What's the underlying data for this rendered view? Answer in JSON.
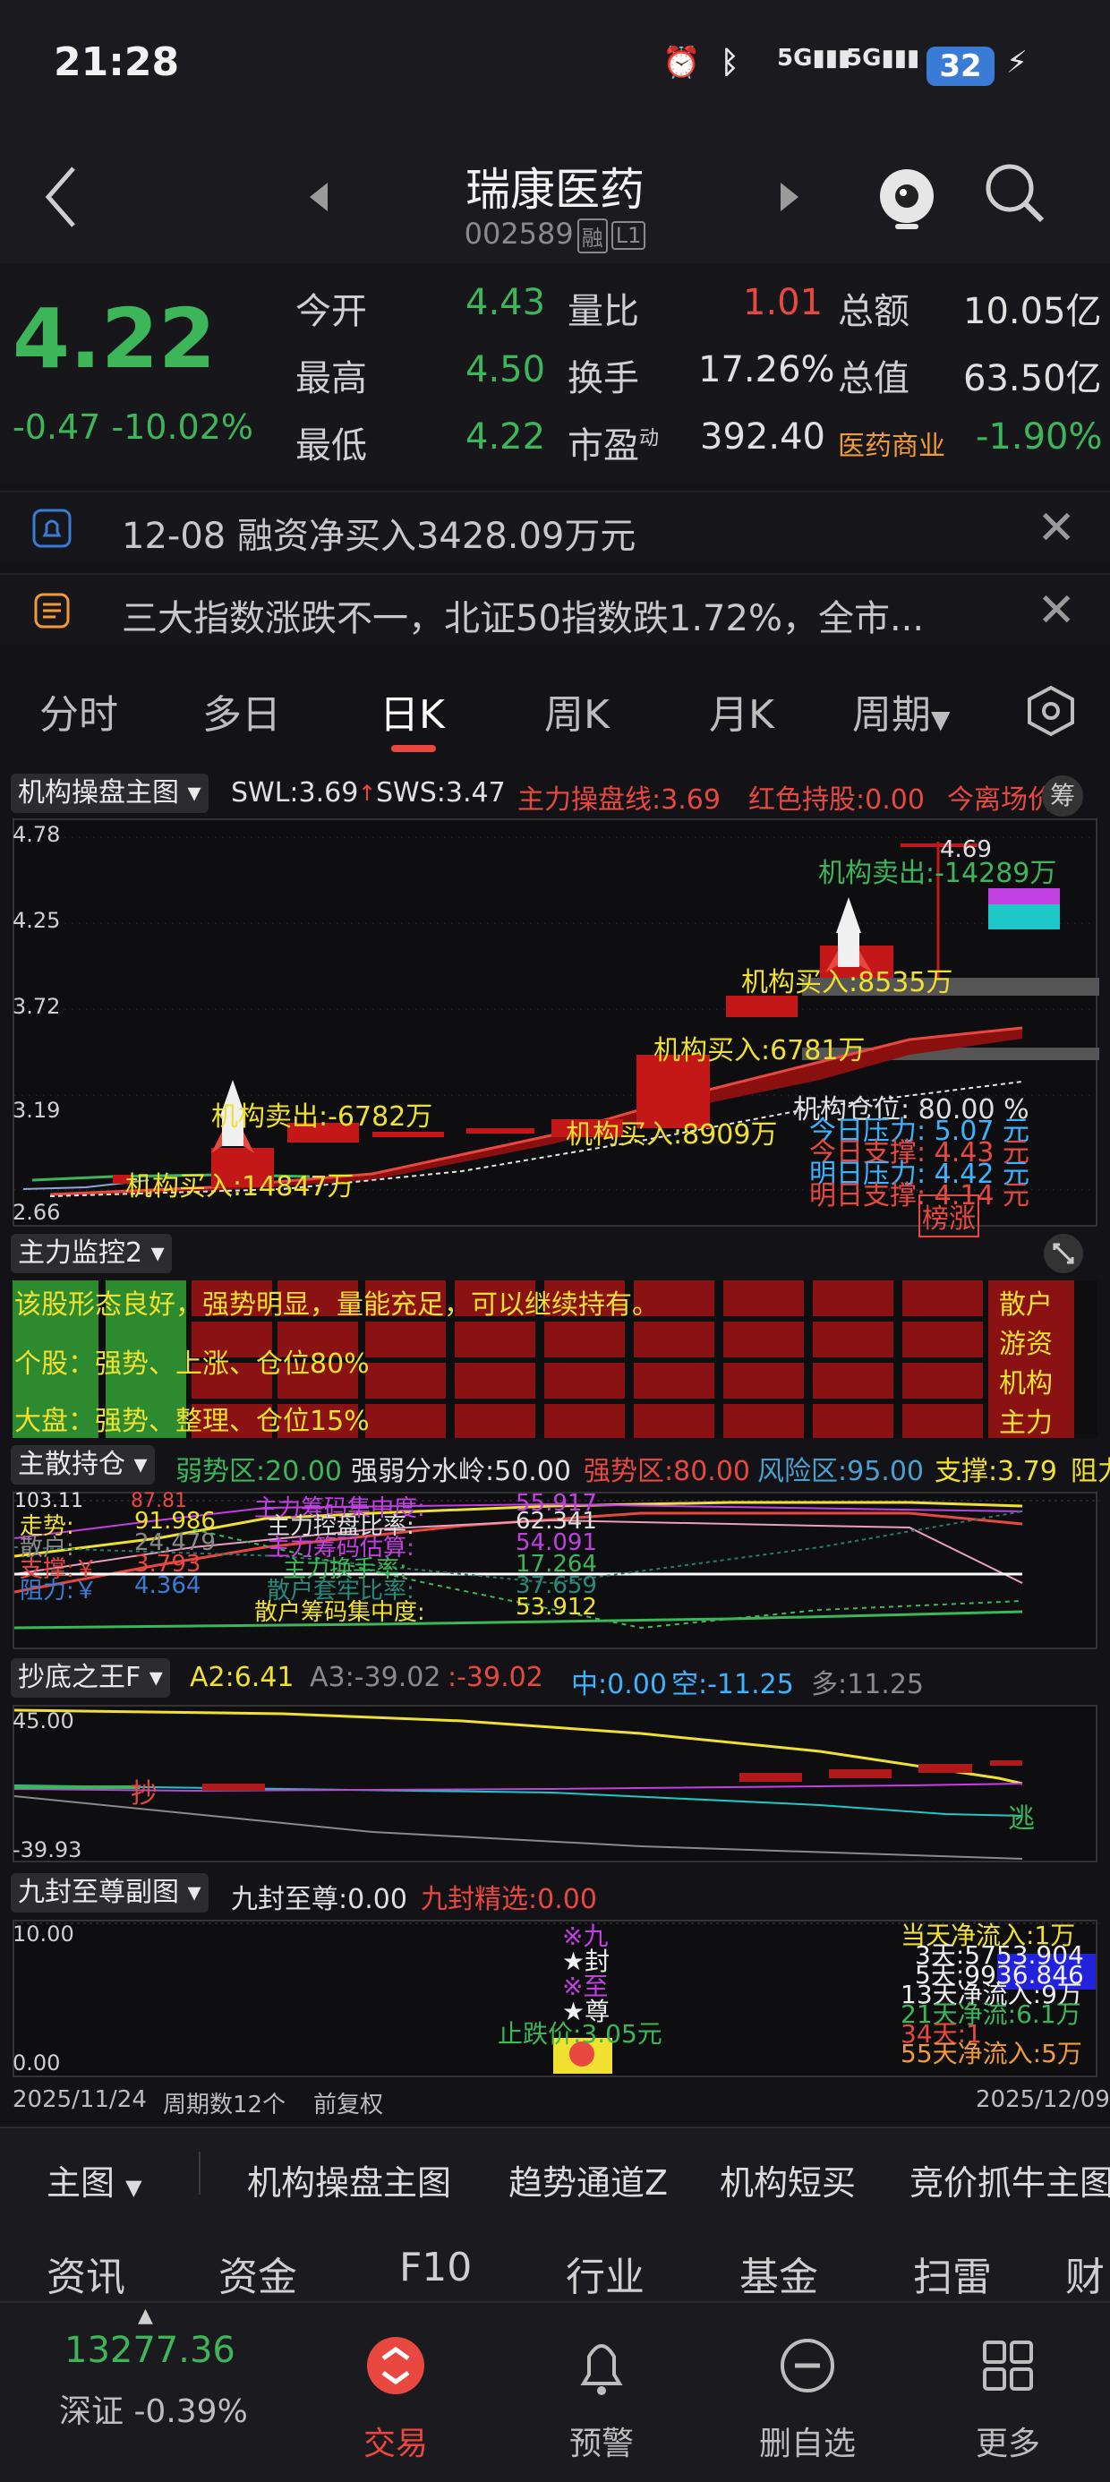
{
  "status": {
    "time": "21:28",
    "battery": "32",
    "net1": "5G",
    "net2": "5G"
  },
  "header": {
    "name": "瑞康医药",
    "code": "002589",
    "tag1": "融",
    "tag2": "L1"
  },
  "quote": {
    "price": "4.22",
    "change": "-0.47 -10.02%",
    "labels": [
      "今开",
      "最高",
      "最低",
      "量比",
      "换手",
      "市盈",
      "总额",
      "总值"
    ],
    "open": "4.43",
    "high": "4.50",
    "low": "4.22",
    "volume_ratio": "1.01",
    "turnover": "17.26%",
    "pe": "392.40",
    "pe_sup": "动",
    "amount": "10.05亿",
    "market_cap": "63.50亿",
    "sector": "医药商业",
    "sector_change": "-1.90%"
  },
  "banners": {
    "margin": "12-08 融资净买入3428.09万元",
    "news": "三大指数涨跌不一，北证50指数跌1.72%，全市..."
  },
  "tabs": [
    "分时",
    "多日",
    "日K",
    "周K",
    "月K",
    "周期"
  ],
  "main_chart": {
    "selector": "机构操盘主图",
    "swl": "SWL:3.69",
    "sws": "SWS:3.47",
    "zl": "主力操盘线:3.69",
    "hs": "红色持股:0.00",
    "jl": "今离场价",
    "chou": "筹",
    "y_ticks": [
      "4.78",
      "4.25",
      "3.72",
      "3.19",
      "2.66"
    ],
    "annotations": {
      "sell1": "机构卖出:-14289万",
      "peak": "4.69",
      "buy1": "机构买入:8535万",
      "buy2": "机构买入:6781万",
      "sell2": "机构卖出:-6782万",
      "buy3": "机构买入:8909万",
      "buy4": "机构买入:14847万",
      "pos": "机构仓位:  80.00 %",
      "p1": "今日压力:  5.07 元",
      "p2": "今日支撑:  4.43 元",
      "p3": "明日压力:  4.42 元",
      "p4": "明日支撑:  4.14 元",
      "bang": "榜涨"
    }
  },
  "monitor": {
    "selector": "主力监控2",
    "line1": "该股形态良好，强势明显，量能充足，可以继续持有。",
    "line2": "个股：强势、上涨、仓位80%",
    "line3": "大盘：强势、整理、仓位15%",
    "side": [
      "散户",
      "游资",
      "机构",
      "主力"
    ]
  },
  "holding": {
    "selector": "主散持仓",
    "weak": "弱势区:20.00",
    "water": "强弱分水岭:50.00",
    "strong": "强势区:80.00",
    "risk": "风险区:95.00",
    "support": "支撑:3.79",
    "resist": "阻力",
    "rows": [
      [
        "走势:",
        "91.986",
        "主力控盘比率:",
        "62.341"
      ],
      [
        "散户:",
        "24.479",
        "主力筹码估算:",
        "54.091"
      ],
      [
        "支撑:￥",
        "3.793",
        "主力换手率:",
        "17.264"
      ],
      [
        "阻力:￥",
        "4.364",
        "散户套牢比率:",
        "37.659"
      ]
    ],
    "bottom": "散户筹码集中度:",
    "bottom_val": "53.912",
    "top_left": "103.11",
    "top_mid": "主力筹码集中度:",
    "top_mid_val": "55.917",
    "top_small": "87.81"
  },
  "bottom_king": {
    "selector": "抄底之王F",
    "a2": "A2:6.41",
    "a3": "A3:-39.02",
    "x": ":-39.02",
    "zhong": "中:0.00",
    "kong": "空:-11.25",
    "duo": "多:11.25",
    "ytop": "45.00",
    "ybot": "-39.93",
    "chao": "抄",
    "tao": "逃"
  },
  "nine": {
    "selector": "九封至尊副图",
    "a": "九封至尊:0.00",
    "b": "九封精选:0.00",
    "ytop": "10.00",
    "ybot": "0.00",
    "stop": "止跌价:3.05元",
    "col": [
      "※九",
      "★封",
      "※至",
      "★尊"
    ],
    "right": [
      "当天净流入:1万",
      "3天:5753.904",
      "5天:9936.846",
      "13天净流入:9万",
      "21天净流:6.1万",
      "34天:1",
      "55天净流入:5万"
    ],
    "vals": [
      "5753.904",
      "9936.846"
    ]
  },
  "dates": {
    "start": "2025/11/24",
    "count": "周期数12个",
    "adj": "前复权",
    "end": "2025/12/09"
  },
  "menu": {
    "main": "主图",
    "items": [
      "机构操盘主图",
      "趋势通道Z",
      "机构短买",
      "竞价抓牛主图"
    ]
  },
  "func_tabs": [
    "资讯",
    "资金",
    "F10",
    "行业",
    "基金",
    "扫雷",
    "财"
  ],
  "nav": {
    "index_val": "13277.36",
    "index_name": "深证 -0.39%",
    "items": [
      "交易",
      "预警",
      "删自选",
      "更多"
    ]
  },
  "colors": {
    "up": "#e8483f",
    "down": "#3db65a",
    "accent": "#e8483f",
    "bg": "#131317"
  }
}
